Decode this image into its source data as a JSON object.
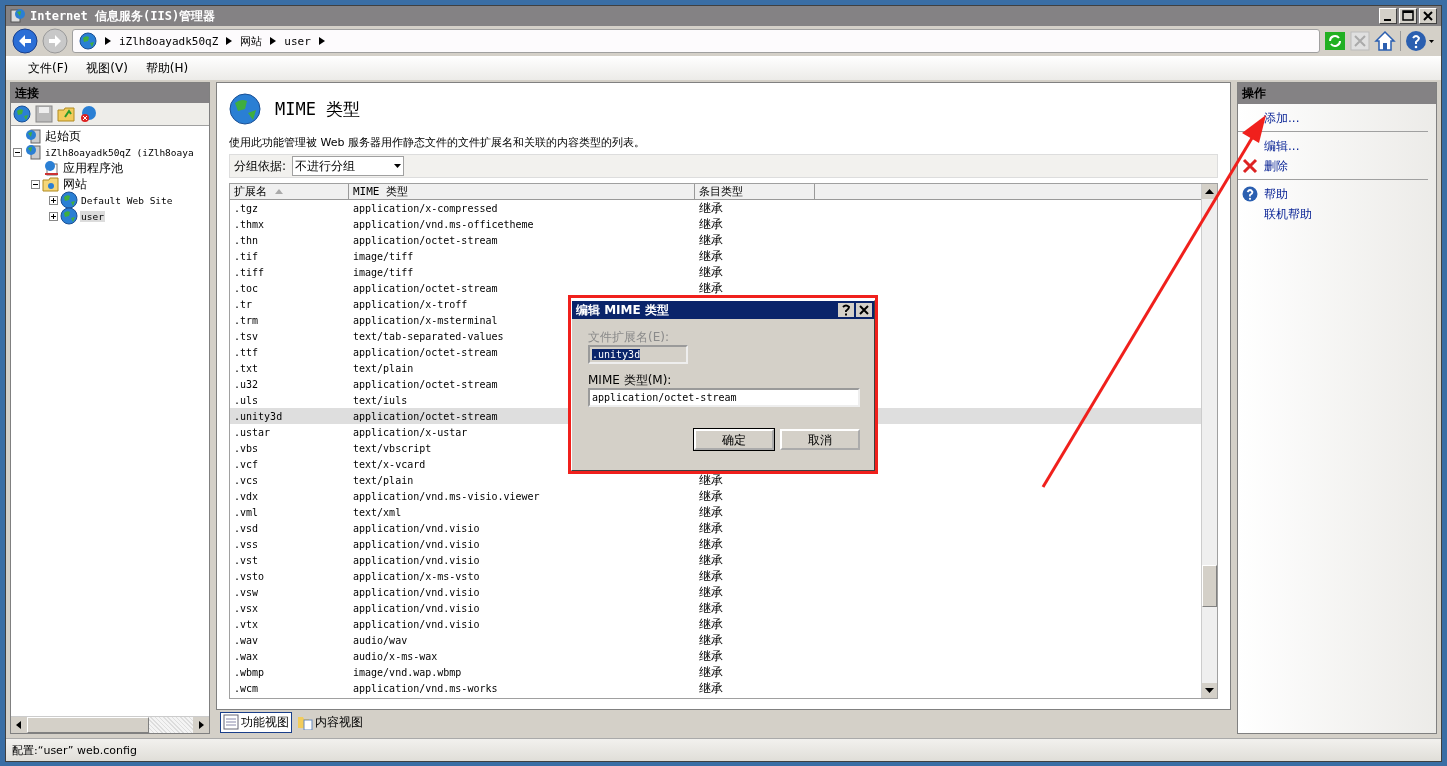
{
  "window": {
    "title": "Internet 信息服务(IIS)管理器"
  },
  "breadcrumb": [
    "iZlh8oayadk50qZ",
    "网站",
    "user"
  ],
  "menu": [
    "文件(F)",
    "视图(V)",
    "帮助(H)"
  ],
  "connections": {
    "title": "连接",
    "tree": [
      {
        "label": "起始页",
        "kind": "start"
      },
      {
        "label": "iZlh8oayadk50qZ (iZlh8oaya",
        "kind": "server",
        "expanded": true,
        "selected": false,
        "children": [
          {
            "label": "应用程序池",
            "kind": "pool"
          },
          {
            "label": "网站",
            "kind": "folder",
            "expanded": true,
            "selected": false,
            "children": [
              {
                "label": "Default Web Site",
                "kind": "site",
                "expanded": false,
                "selected": false
              },
              {
                "label": "user",
                "kind": "site",
                "expanded": false,
                "selected": true
              }
            ]
          }
        ]
      }
    ]
  },
  "feature": {
    "title": "MIME 类型",
    "description": "使用此功能管理被 Web 服务器用作静态文件的文件扩展名和关联的内容类型的列表。",
    "group_by": {
      "label": "分组依据:",
      "value": "不进行分组"
    },
    "columns": [
      {
        "label": "扩展名",
        "sorted": true
      },
      {
        "label": "MIME 类型",
        "sorted": false
      },
      {
        "label": "条目类型",
        "sorted": false
      }
    ],
    "rows": [
      {
        "extension": ".tgz",
        "mime_type": "application/x-compressed",
        "entry_type": "继承",
        "selected": false
      },
      {
        "extension": ".thmx",
        "mime_type": "application/vnd.ms-officetheme",
        "entry_type": "继承",
        "selected": false
      },
      {
        "extension": ".thn",
        "mime_type": "application/octet-stream",
        "entry_type": "继承",
        "selected": false
      },
      {
        "extension": ".tif",
        "mime_type": "image/tiff",
        "entry_type": "继承",
        "selected": false
      },
      {
        "extension": ".tiff",
        "mime_type": "image/tiff",
        "entry_type": "继承",
        "selected": false
      },
      {
        "extension": ".toc",
        "mime_type": "application/octet-stream",
        "entry_type": "继承",
        "selected": false
      },
      {
        "extension": ".tr",
        "mime_type": "application/x-troff",
        "selected": false
      },
      {
        "extension": ".trm",
        "mime_type": "application/x-msterminal",
        "selected": false
      },
      {
        "extension": ".tsv",
        "mime_type": "text/tab-separated-values",
        "selected": false
      },
      {
        "extension": ".ttf",
        "mime_type": "application/octet-stream",
        "selected": false
      },
      {
        "extension": ".txt",
        "mime_type": "text/plain",
        "selected": false
      },
      {
        "extension": ".u32",
        "mime_type": "application/octet-stream",
        "selected": false
      },
      {
        "extension": ".uls",
        "mime_type": "text/iuls",
        "selected": false
      },
      {
        "extension": ".unity3d",
        "mime_type": "application/octet-stream",
        "selected": true
      },
      {
        "extension": ".ustar",
        "mime_type": "application/x-ustar",
        "selected": false
      },
      {
        "extension": ".vbs",
        "mime_type": "text/vbscript",
        "selected": false
      },
      {
        "extension": ".vcf",
        "mime_type": "text/x-vcard",
        "selected": false
      },
      {
        "extension": ".vcs",
        "mime_type": "text/plain",
        "entry_type": "继承",
        "selected": false
      },
      {
        "extension": ".vdx",
        "mime_type": "application/vnd.ms-visio.viewer",
        "entry_type": "继承",
        "selected": false
      },
      {
        "extension": ".vml",
        "mime_type": "text/xml",
        "entry_type": "继承",
        "selected": false
      },
      {
        "extension": ".vsd",
        "mime_type": "application/vnd.visio",
        "entry_type": "继承",
        "selected": false
      },
      {
        "extension": ".vss",
        "mime_type": "application/vnd.visio",
        "entry_type": "继承",
        "selected": false
      },
      {
        "extension": ".vst",
        "mime_type": "application/vnd.visio",
        "entry_type": "继承",
        "selected": false
      },
      {
        "extension": ".vsto",
        "mime_type": "application/x-ms-vsto",
        "entry_type": "继承",
        "selected": false
      },
      {
        "extension": ".vsw",
        "mime_type": "application/vnd.visio",
        "entry_type": "继承",
        "selected": false
      },
      {
        "extension": ".vsx",
        "mime_type": "application/vnd.visio",
        "entry_type": "继承",
        "selected": false
      },
      {
        "extension": ".vtx",
        "mime_type": "application/vnd.visio",
        "entry_type": "继承",
        "selected": false
      },
      {
        "extension": ".wav",
        "mime_type": "audio/wav",
        "entry_type": "继承",
        "selected": false
      },
      {
        "extension": ".wax",
        "mime_type": "audio/x-ms-wax",
        "entry_type": "继承",
        "selected": false
      },
      {
        "extension": ".wbmp",
        "mime_type": "image/vnd.wap.wbmp",
        "entry_type": "继承",
        "selected": false
      },
      {
        "extension": ".wcm",
        "mime_type": "application/vnd.ms-works",
        "entry_type": "继承",
        "selected": false
      }
    ]
  },
  "view_tabs": [
    {
      "label": "功能视图",
      "selected": true
    },
    {
      "label": "内容视图",
      "selected": false
    }
  ],
  "actions": {
    "title": "操作",
    "groups": [
      [
        {
          "label": "添加...",
          "kind": "plain"
        }
      ],
      [
        {
          "label": "编辑...",
          "kind": "plain"
        },
        {
          "label": "删除",
          "kind": "delete"
        }
      ],
      [
        {
          "label": "帮助",
          "kind": "help"
        },
        {
          "label": "联机帮助",
          "kind": "plain"
        }
      ]
    ]
  },
  "dialog": {
    "title": "编辑 MIME 类型",
    "fields": [
      {
        "label": "文件扩展名(E):",
        "value": ".unity3d",
        "disabled": true
      },
      {
        "label": "MIME 类型(M):",
        "value": "application/octet-stream",
        "disabled": false
      }
    ],
    "buttons": [
      {
        "label": "确定",
        "default": true
      },
      {
        "label": "取消",
        "default": false
      }
    ]
  },
  "status_bar": "配置:“user” web.config"
}
